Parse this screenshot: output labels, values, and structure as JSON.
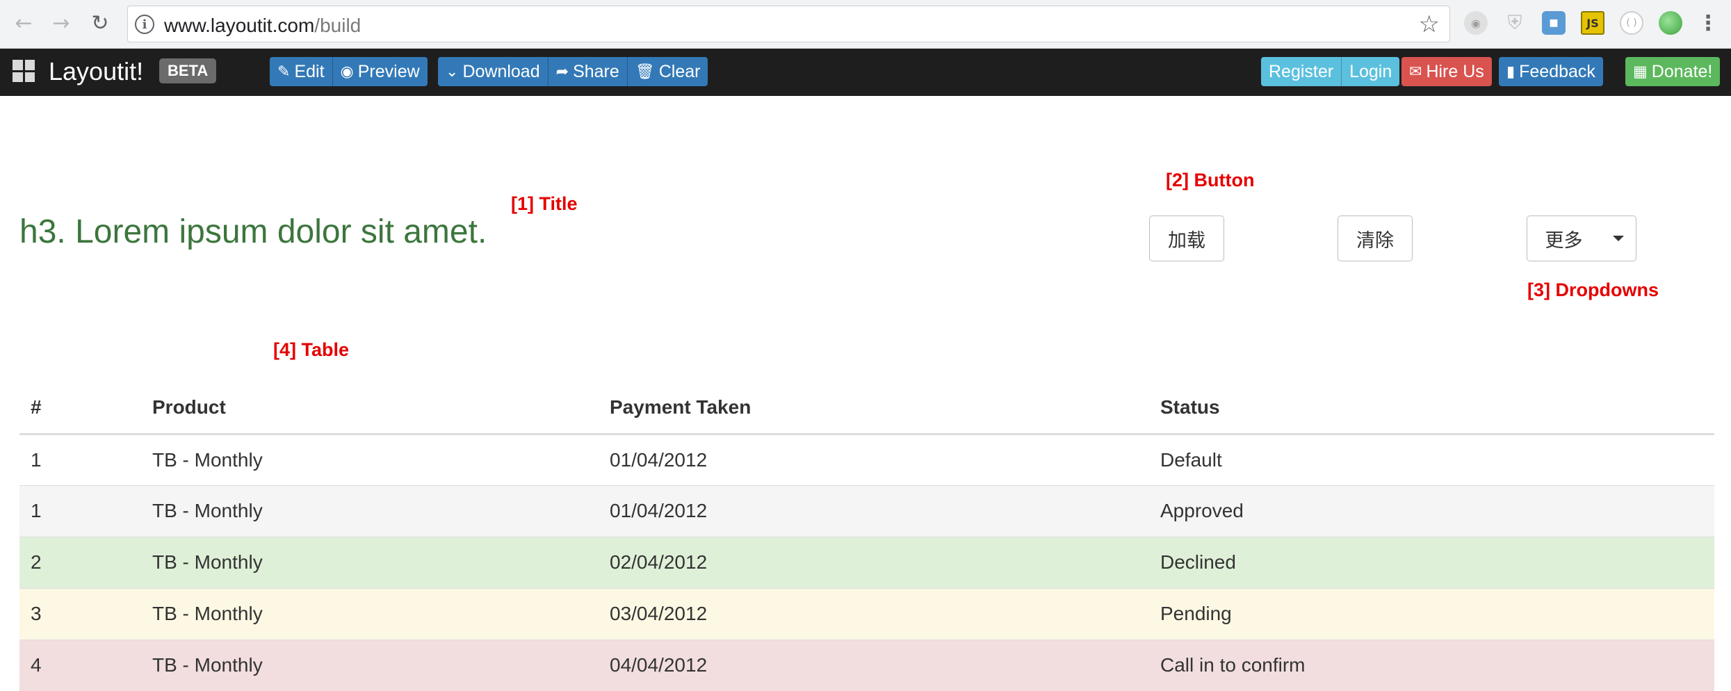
{
  "browser": {
    "url_domain": "www.layoutit.com",
    "url_path": "/build"
  },
  "topbar": {
    "brand": "Layoutit!",
    "badge": "BETA",
    "edit": "Edit",
    "preview": "Preview",
    "download": "Download",
    "share": "Share",
    "clear": "Clear",
    "register": "Register",
    "login": "Login",
    "hire_us": "Hire Us",
    "feedback": "Feedback",
    "donate": "Donate!"
  },
  "content": {
    "heading": "h3. Lorem ipsum dolor sit amet.",
    "btn_load": "加载",
    "btn_clear": "清除",
    "btn_more": "更多"
  },
  "annotations": {
    "title": "[1] Title",
    "button": "[2] Button",
    "dropdowns": "[3] Dropdowns",
    "table": "[4] Table"
  },
  "table": {
    "headers": [
      "#",
      "Product",
      "Payment Taken",
      "Status"
    ],
    "rows": [
      {
        "num": "1",
        "product": "TB - Monthly",
        "payment": "01/04/2012",
        "status": "Default",
        "style": "default"
      },
      {
        "num": "1",
        "product": "TB - Monthly",
        "payment": "01/04/2012",
        "status": "Approved",
        "style": "active"
      },
      {
        "num": "2",
        "product": "TB - Monthly",
        "payment": "02/04/2012",
        "status": "Declined",
        "style": "success"
      },
      {
        "num": "3",
        "product": "TB - Monthly",
        "payment": "03/04/2012",
        "status": "Pending",
        "style": "warning"
      },
      {
        "num": "4",
        "product": "TB - Monthly",
        "payment": "04/04/2012",
        "status": "Call in to confirm",
        "style": "danger"
      }
    ]
  },
  "colors": {
    "topbar_bg": "#1e1e1e",
    "primary": "#3379b7",
    "info": "#5bc0de",
    "danger": "#d9534f",
    "success": "#5cb85c",
    "heading": "#3c763d",
    "annotation": "#e60000"
  }
}
